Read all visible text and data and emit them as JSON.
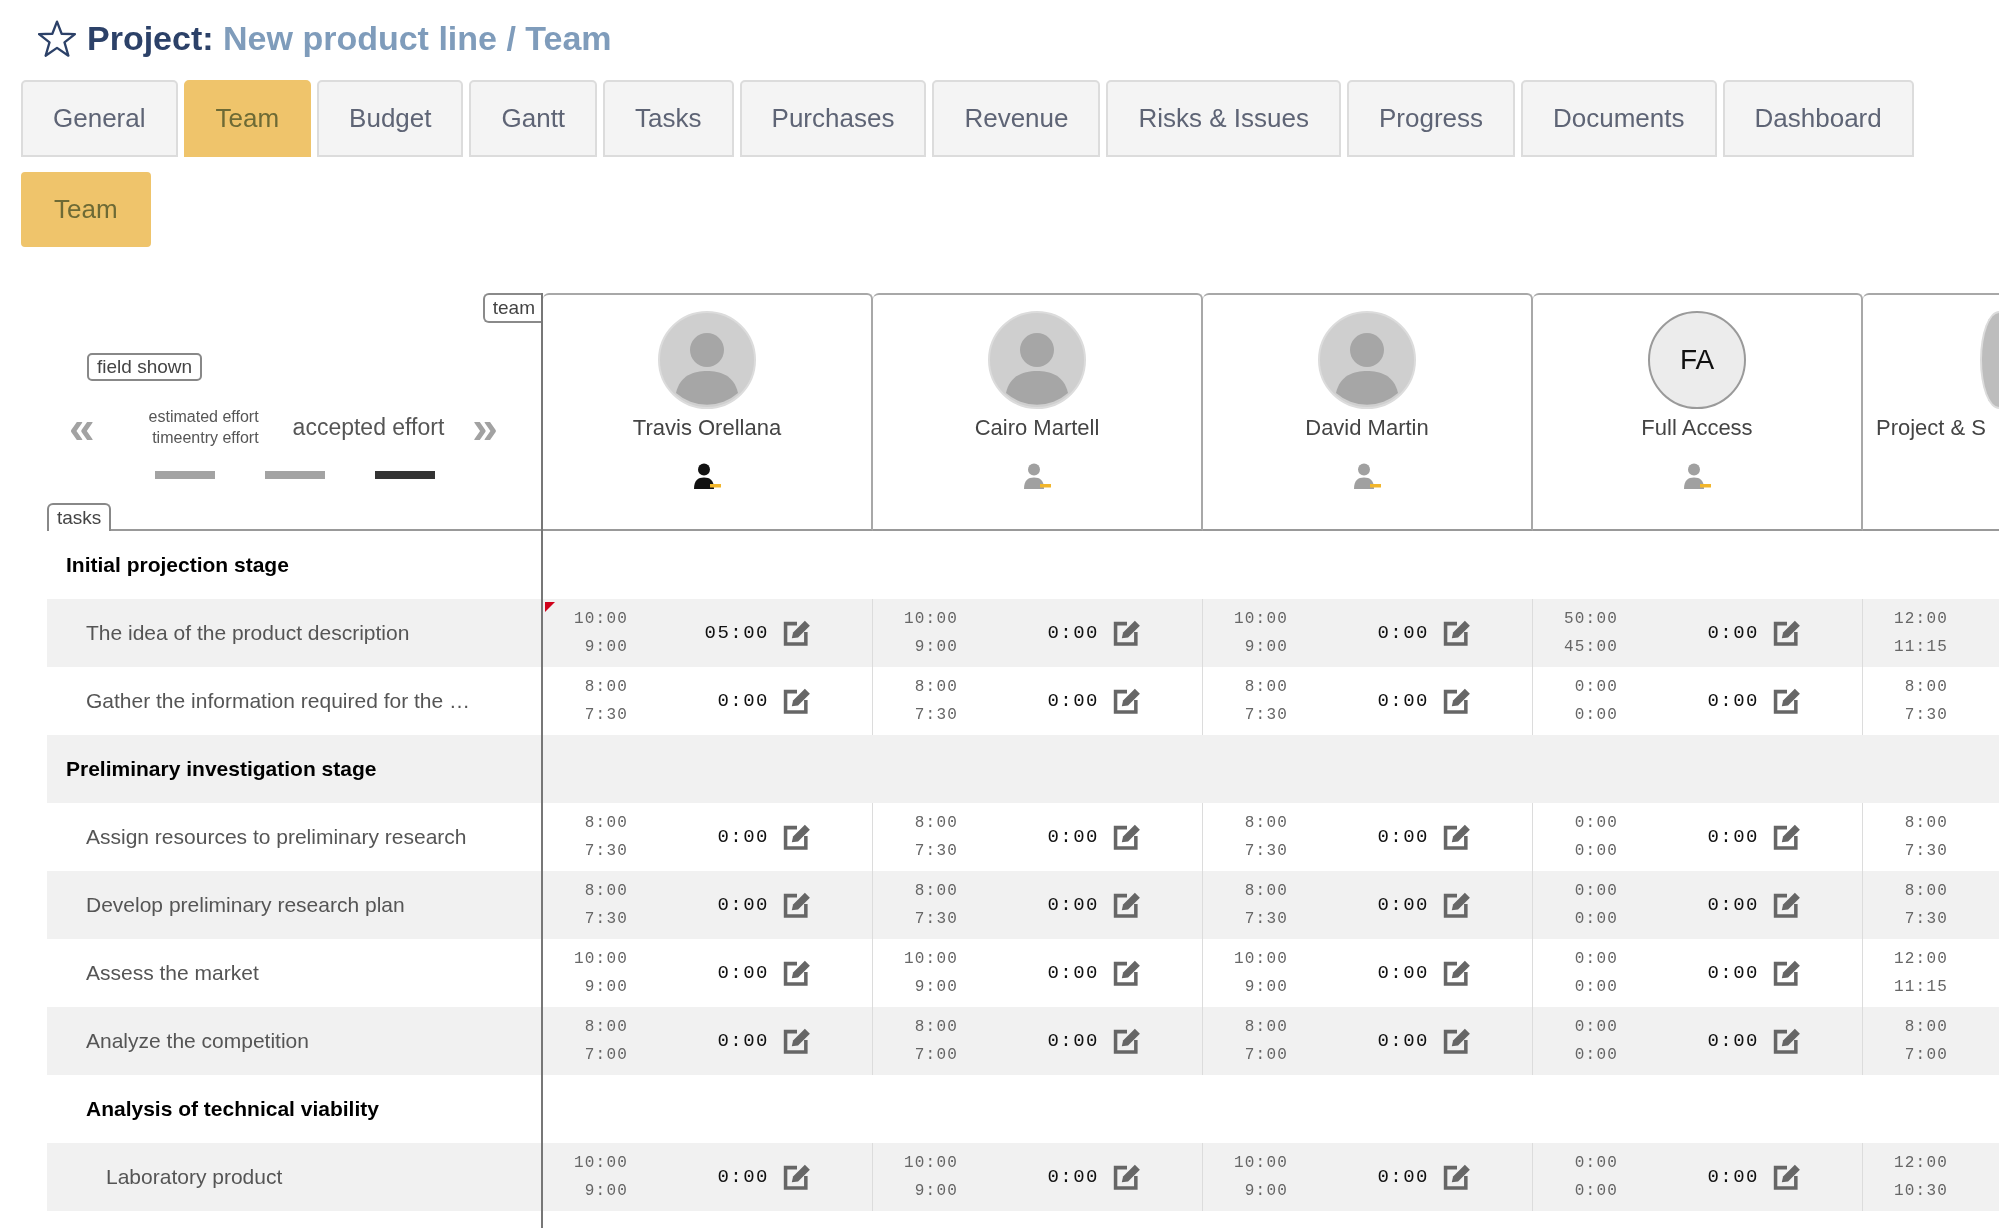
{
  "title": {
    "label": "Project:",
    "name": "New product line / Team"
  },
  "tabs": [
    {
      "label": "General",
      "selected": false
    },
    {
      "label": "Team",
      "selected": true
    },
    {
      "label": "Budget",
      "selected": false
    },
    {
      "label": "Gantt",
      "selected": false
    },
    {
      "label": "Tasks",
      "selected": false
    },
    {
      "label": "Purchases",
      "selected": false
    },
    {
      "label": "Revenue",
      "selected": false
    },
    {
      "label": "Risks & Issues",
      "selected": false
    },
    {
      "label": "Progress",
      "selected": false
    },
    {
      "label": "Documents",
      "selected": false
    },
    {
      "label": "Dashboard",
      "selected": false
    }
  ],
  "subtabs": [
    {
      "label": "Team",
      "selected": true
    }
  ],
  "team_label": "team",
  "tasks_label": "tasks",
  "field_switcher": {
    "label": "field shown",
    "prev": "«",
    "next": "»",
    "fields": [
      {
        "label": "estimated effort",
        "selected": false
      },
      {
        "label": "timeentry effort",
        "selected": false
      },
      {
        "label": "accepted effort",
        "selected": true
      }
    ]
  },
  "members": [
    {
      "name": "Travis Orellana",
      "kind": "photo",
      "role_active": true
    },
    {
      "name": "Cairo Martell",
      "kind": "photo",
      "role_active": false
    },
    {
      "name": "David Martin",
      "kind": "photo",
      "role_active": false
    },
    {
      "name": "Full Access",
      "kind": "initials",
      "initials": "FA",
      "role_active": false
    },
    {
      "name": "Project & S",
      "kind": "photo"
    }
  ],
  "rows": [
    {
      "kind": "group",
      "title": "Initial projection stage",
      "children": [
        {
          "kind": "task",
          "title": "The idea of the product description",
          "flagged": true,
          "cells": [
            {
              "estimated": "10:00",
              "timeentry": "9:00",
              "accepted": "05:00"
            },
            {
              "estimated": "10:00",
              "timeentry": "9:00",
              "accepted": "0:00"
            },
            {
              "estimated": "10:00",
              "timeentry": "9:00",
              "accepted": "0:00"
            },
            {
              "estimated": "50:00",
              "timeentry": "45:00",
              "accepted": "0:00"
            },
            {
              "estimated": "12:00",
              "timeentry": "11:15"
            }
          ]
        },
        {
          "kind": "task",
          "title": "Gather the information required for the …",
          "flagged": false,
          "cells": [
            {
              "estimated": "8:00",
              "timeentry": "7:30",
              "accepted": "0:00"
            },
            {
              "estimated": "8:00",
              "timeentry": "7:30",
              "accepted": "0:00"
            },
            {
              "estimated": "8:00",
              "timeentry": "7:30",
              "accepted": "0:00"
            },
            {
              "estimated": "0:00",
              "timeentry": "0:00",
              "accepted": "0:00"
            },
            {
              "estimated": "8:00",
              "timeentry": "7:30"
            }
          ]
        }
      ]
    },
    {
      "kind": "group",
      "title": "Preliminary investigation stage",
      "children": [
        {
          "kind": "task",
          "title": "Assign resources to preliminary research",
          "flagged": false,
          "cells": [
            {
              "estimated": "8:00",
              "timeentry": "7:30",
              "accepted": "0:00"
            },
            {
              "estimated": "8:00",
              "timeentry": "7:30",
              "accepted": "0:00"
            },
            {
              "estimated": "8:00",
              "timeentry": "7:30",
              "accepted": "0:00"
            },
            {
              "estimated": "0:00",
              "timeentry": "0:00",
              "accepted": "0:00"
            },
            {
              "estimated": "8:00",
              "timeentry": "7:30"
            }
          ]
        },
        {
          "kind": "task",
          "title": "Develop preliminary research plan",
          "flagged": false,
          "cells": [
            {
              "estimated": "8:00",
              "timeentry": "7:30",
              "accepted": "0:00"
            },
            {
              "estimated": "8:00",
              "timeentry": "7:30",
              "accepted": "0:00"
            },
            {
              "estimated": "8:00",
              "timeentry": "7:30",
              "accepted": "0:00"
            },
            {
              "estimated": "0:00",
              "timeentry": "0:00",
              "accepted": "0:00"
            },
            {
              "estimated": "8:00",
              "timeentry": "7:30"
            }
          ]
        },
        {
          "kind": "task",
          "title": "Assess the market",
          "flagged": false,
          "cells": [
            {
              "estimated": "10:00",
              "timeentry": "9:00",
              "accepted": "0:00"
            },
            {
              "estimated": "10:00",
              "timeentry": "9:00",
              "accepted": "0:00"
            },
            {
              "estimated": "10:00",
              "timeentry": "9:00",
              "accepted": "0:00"
            },
            {
              "estimated": "0:00",
              "timeentry": "0:00",
              "accepted": "0:00"
            },
            {
              "estimated": "12:00",
              "timeentry": "11:15"
            }
          ]
        },
        {
          "kind": "task",
          "title": "Analyze the competition",
          "flagged": false,
          "cells": [
            {
              "estimated": "8:00",
              "timeentry": "7:00",
              "accepted": "0:00"
            },
            {
              "estimated": "8:00",
              "timeentry": "7:00",
              "accepted": "0:00"
            },
            {
              "estimated": "8:00",
              "timeentry": "7:00",
              "accepted": "0:00"
            },
            {
              "estimated": "0:00",
              "timeentry": "0:00",
              "accepted": "0:00"
            },
            {
              "estimated": "8:00",
              "timeentry": "7:00"
            }
          ]
        },
        {
          "kind": "group",
          "title": "Analysis of technical viability",
          "children": [
            {
              "kind": "task",
              "title": "Laboratory product",
              "flagged": false,
              "cells": [
                {
                  "estimated": "10:00",
                  "timeentry": "9:00",
                  "accepted": "0:00"
                },
                {
                  "estimated": "10:00",
                  "timeentry": "9:00",
                  "accepted": "0:00"
                },
                {
                  "estimated": "10:00",
                  "timeentry": "9:00",
                  "accepted": "0:00"
                },
                {
                  "estimated": "0:00",
                  "timeentry": "0:00",
                  "accepted": "0:00"
                },
                {
                  "estimated": "12:00",
                  "timeentry": "10:30"
                }
              ]
            }
          ]
        }
      ]
    }
  ]
}
